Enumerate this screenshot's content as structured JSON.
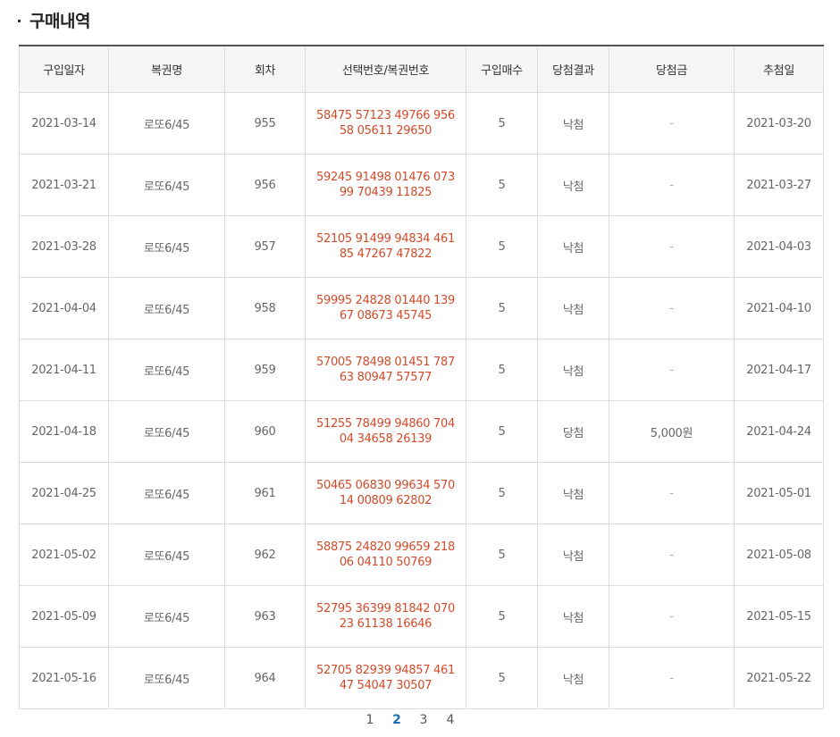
{
  "section": {
    "title": "구매내역"
  },
  "table": {
    "headers": [
      "구입일자",
      "복권명",
      "회차",
      "선택번호/복권번호",
      "구입매수",
      "당첨결과",
      "당첨금",
      "추첨일"
    ],
    "rows": [
      {
        "date": "2021-03-14",
        "name": "로또6/45",
        "round": "955",
        "numbers": "58475 57123 49766 95658 05611 29650",
        "qty": "5",
        "result": "낙첨",
        "prize": "-",
        "draw": "2021-03-20"
      },
      {
        "date": "2021-03-21",
        "name": "로또6/45",
        "round": "956",
        "numbers": "59245 91498 01476 07399 70439 11825",
        "qty": "5",
        "result": "낙첨",
        "prize": "-",
        "draw": "2021-03-27"
      },
      {
        "date": "2021-03-28",
        "name": "로또6/45",
        "round": "957",
        "numbers": "52105 91499 94834 46185 47267 47822",
        "qty": "5",
        "result": "낙첨",
        "prize": "-",
        "draw": "2021-04-03"
      },
      {
        "date": "2021-04-04",
        "name": "로또6/45",
        "round": "958",
        "numbers": "59995 24828 01440 13967 08673 45745",
        "qty": "5",
        "result": "낙첨",
        "prize": "-",
        "draw": "2021-04-10"
      },
      {
        "date": "2021-04-11",
        "name": "로또6/45",
        "round": "959",
        "numbers": "57005 78498 01451 78763 80947 57577",
        "qty": "5",
        "result": "낙첨",
        "prize": "-",
        "draw": "2021-04-17"
      },
      {
        "date": "2021-04-18",
        "name": "로또6/45",
        "round": "960",
        "numbers": "51255 78499 94860 70404 34658 26139",
        "qty": "5",
        "result": "당첨",
        "prize": "5,000원",
        "draw": "2021-04-24"
      },
      {
        "date": "2021-04-25",
        "name": "로또6/45",
        "round": "961",
        "numbers": "50465 06830 99634 57014 00809 62802",
        "qty": "5",
        "result": "낙첨",
        "prize": "-",
        "draw": "2021-05-01"
      },
      {
        "date": "2021-05-02",
        "name": "로또6/45",
        "round": "962",
        "numbers": "58875 24820 99659 21806 04110 50769",
        "qty": "5",
        "result": "낙첨",
        "prize": "-",
        "draw": "2021-05-08"
      },
      {
        "date": "2021-05-09",
        "name": "로또6/45",
        "round": "963",
        "numbers": "52795 36399 81842 07023 61138 16646",
        "qty": "5",
        "result": "낙첨",
        "prize": "-",
        "draw": "2021-05-15"
      },
      {
        "date": "2021-05-16",
        "name": "로또6/45",
        "round": "964",
        "numbers": "52705 82939 94857 46147 54047 30507",
        "qty": "5",
        "result": "낙첨",
        "prize": "-",
        "draw": "2021-05-22"
      }
    ]
  },
  "pagination": {
    "pages": [
      "1",
      "2",
      "3",
      "4"
    ],
    "current": "2"
  },
  "colors": {
    "numbers_text": "#d14b2a",
    "current_page": "#1a6fb5",
    "header_bg": "#f5f5f5",
    "border": "#dcdcdc",
    "top_border": "#555555"
  }
}
